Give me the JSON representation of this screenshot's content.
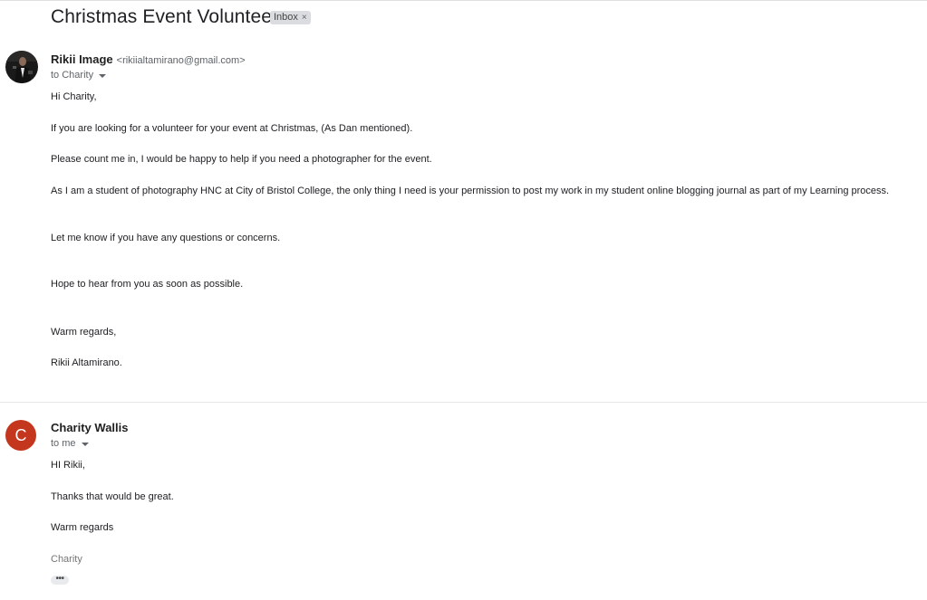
{
  "thread": {
    "subject": "Christmas Event Volunteer.",
    "label": "Inbox",
    "label_remove": "×"
  },
  "messages": [
    {
      "sender_name": "Rikii Image",
      "sender_email": "<rikiialtamirano@gmail.com>",
      "recipients": "to Charity",
      "lines": [
        "Hi Charity,",
        "If you are looking for a volunteer for your event at Christmas, (As Dan mentioned).",
        "Please count me in, I would be happy to help if you need a photographer for the event.",
        "As I am a student of photography HNC at City of Bristol College, the only thing I need is your permission to post my work in my student online blogging journal as part of my Learning process.",
        "Let me know if you have any questions or concerns.",
        "Hope to hear from you as soon as possible.",
        "Warm regards,",
        "Rikii Altamirano."
      ]
    },
    {
      "sender_name": "Charity Wallis",
      "avatar_letter": "C",
      "avatar_color": "#c5361f",
      "recipients": "to me",
      "lines": [
        "HI Rikii,",
        "Thanks that would be great.",
        "Warm regards",
        "Charity"
      ],
      "trimmed_content": "•••"
    }
  ]
}
